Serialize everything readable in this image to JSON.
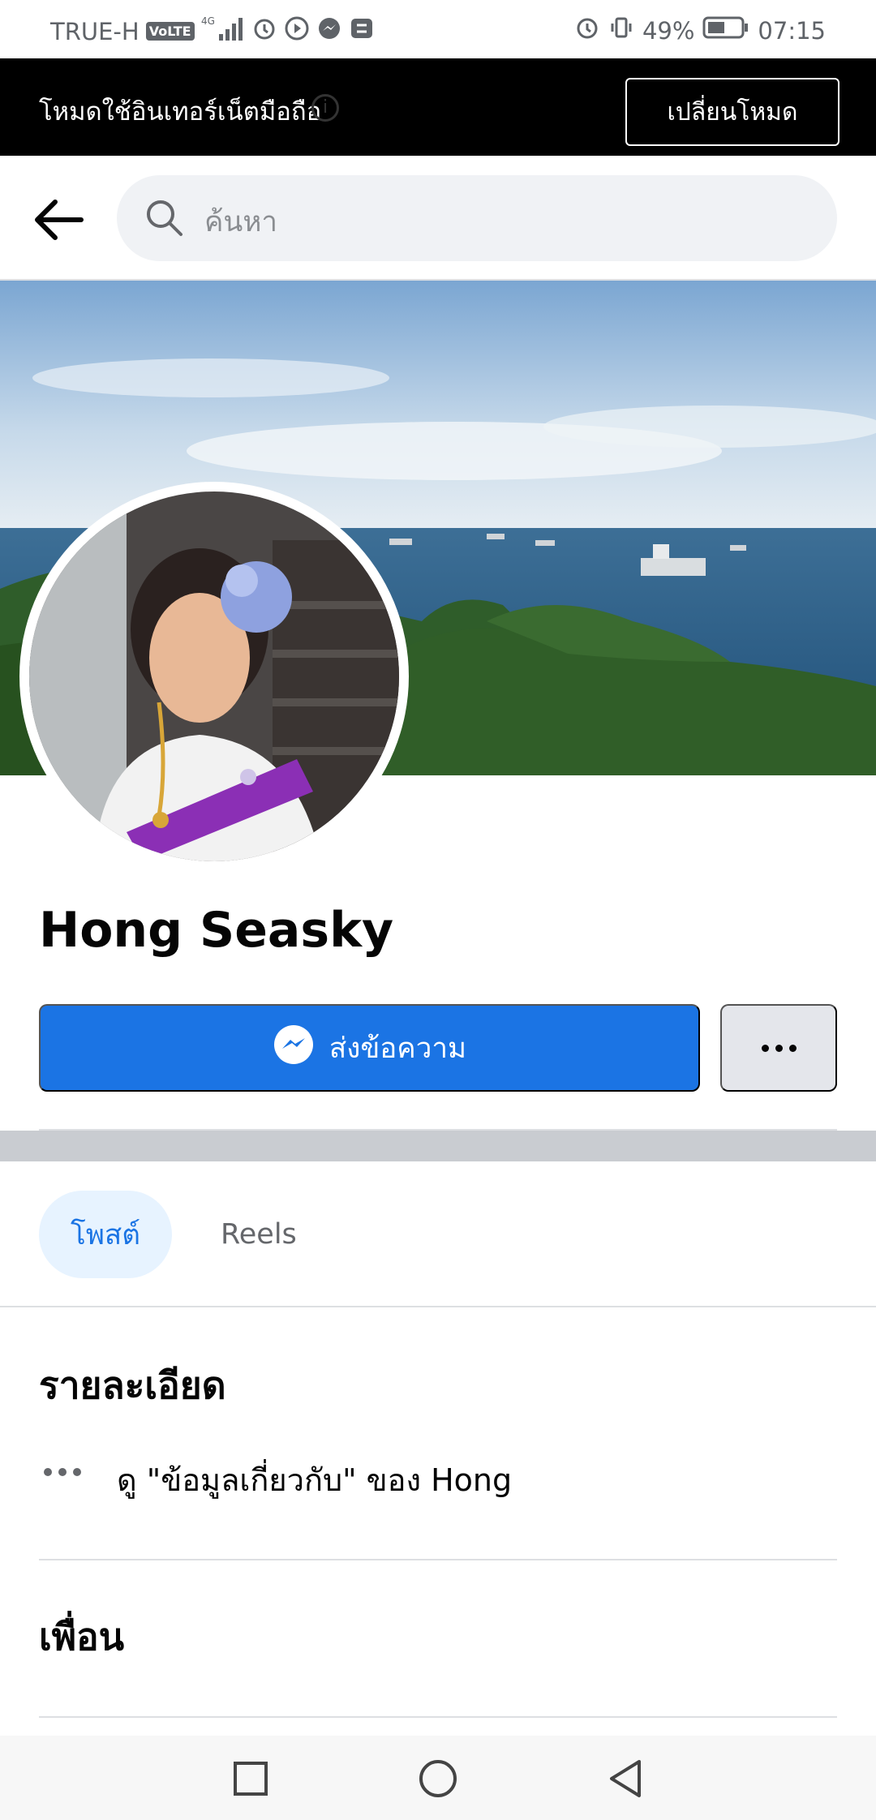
{
  "status_bar": {
    "carrier": "TRUE-H",
    "volte": "VoLTE",
    "network": "4G",
    "battery_percent": "49%",
    "time": "07:15",
    "left_icons": [
      "signal-icon",
      "alarm-icon",
      "play-icon",
      "messenger-icon",
      "app-icon"
    ],
    "right_icons": [
      "alarm-icon",
      "vibrate-icon",
      "battery-icon"
    ]
  },
  "mode_banner": {
    "text": "โหมดใช้อินเทอร์เน็ตมือถือ",
    "button_label": "เปลี่ยนโหมด"
  },
  "search": {
    "placeholder": "ค้นหา"
  },
  "profile": {
    "name": "Hong Seasky",
    "message_button": "ส่งข้อความ"
  },
  "tabs": [
    {
      "label": "โพสต์",
      "active": true
    },
    {
      "label": "Reels",
      "active": false
    }
  ],
  "details": {
    "heading": "รายละเอียด",
    "about_link": "ดู \"ข้อมูลเกี่ยวกับ\" ของ Hong"
  },
  "friends": {
    "heading": "เพื่อน"
  },
  "colors": {
    "accent": "#1b74e4",
    "tab_active_bg": "#e7f3ff",
    "banner_bg": "#000000"
  },
  "nav_bar": {
    "buttons": [
      "recents-icon",
      "home-icon",
      "back-icon"
    ]
  }
}
